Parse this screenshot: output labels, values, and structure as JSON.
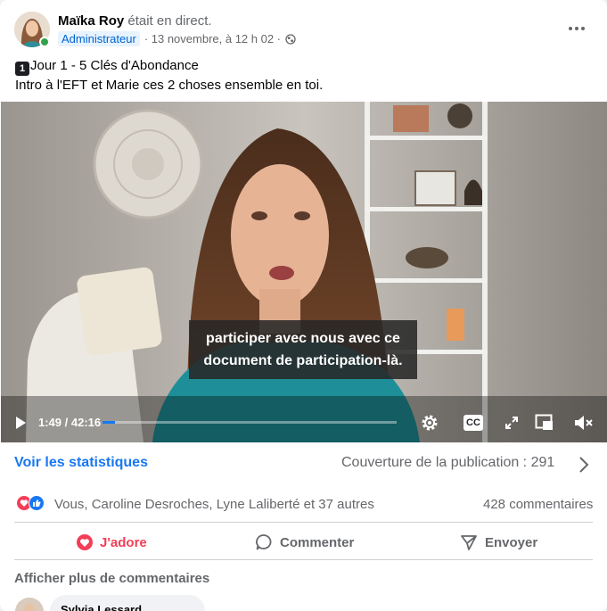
{
  "post": {
    "author": "Maïka Roy",
    "live_text": "était en direct.",
    "badge": "Administrateur",
    "date": "· 13 novembre, à 12 h 02 ·",
    "privacy_icon": "globe-icon",
    "options_icon": "more-options-icon",
    "title_badge": "1",
    "title_line": "Jour 1 - 5 Clés d'Abondance",
    "body_line": "Intro à l'EFT et Marie ces 2 choses ensemble en toi."
  },
  "video": {
    "subtitle_line1": "participer avec nous avec ce",
    "subtitle_line2": "document de participation-là.",
    "time": "1:49 / 42:16",
    "progress": 0.043,
    "controls": [
      "play-icon",
      "settings-icon",
      "captions-icon",
      "fullscreen-icon",
      "mini-player-icon",
      "mute-icon"
    ],
    "captions_label": "CC"
  },
  "insights": {
    "stats_link": "Voir les statistiques",
    "reach": "Couverture de la publication : 291"
  },
  "reactions": {
    "icons": [
      "love-icon",
      "like-icon"
    ],
    "names": "Vous, Caroline Desroches, Lyne Laliberté et 37 autres",
    "comments": "428 commentaires"
  },
  "actions": {
    "love": "J'adore",
    "comment": "Commenter",
    "share": "Envoyer"
  },
  "comments": {
    "more": "Afficher plus de commentaires",
    "first_author": "Sylvia Lessard"
  },
  "colors": {
    "accent": "#1877f2",
    "love": "#f33e58",
    "online": "#31a24c"
  }
}
